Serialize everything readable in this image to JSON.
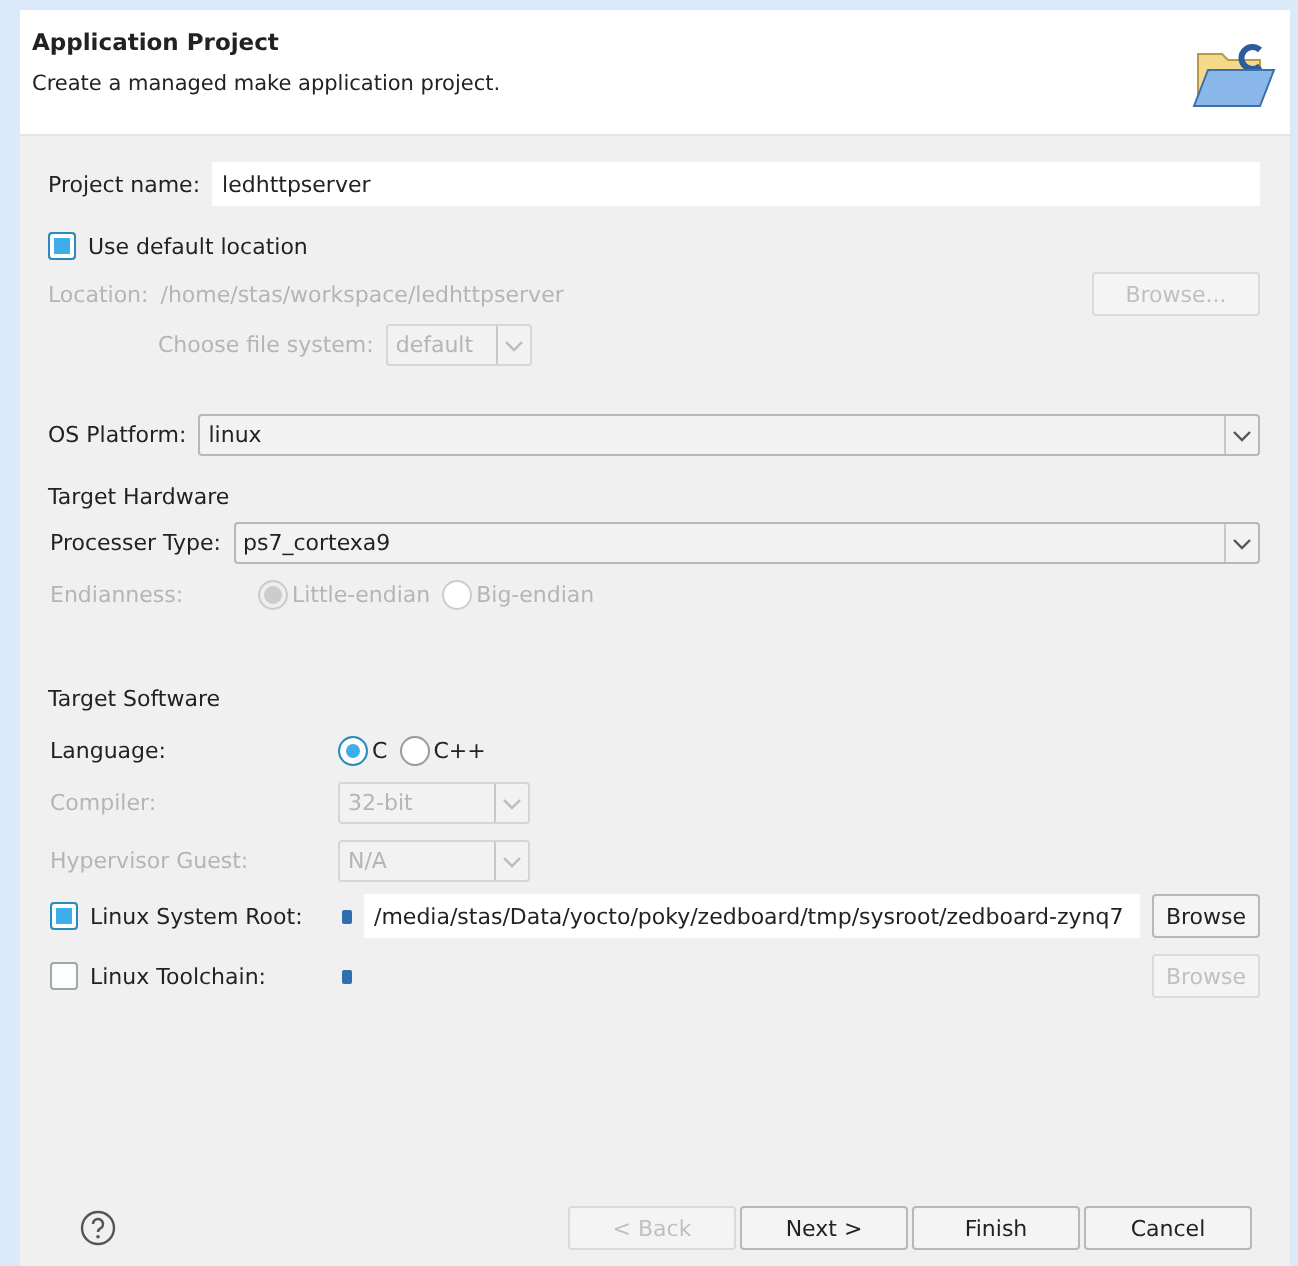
{
  "header": {
    "title": "Application Project",
    "description": "Create a managed make application project."
  },
  "project_name": {
    "label": "Project name:",
    "value": "ledhttpserver"
  },
  "use_default_location": {
    "label": "Use default location",
    "checked": true
  },
  "location": {
    "label": "Location:",
    "value": "/home/stas/workspace/ledhttpserver",
    "disabled": true,
    "browse": {
      "label": "Browse...",
      "disabled": true
    }
  },
  "file_system": {
    "label": "Choose file system:",
    "value": "default",
    "disabled": true
  },
  "os_platform": {
    "label": "OS Platform:",
    "value": "linux"
  },
  "target_hardware": {
    "title": "Target Hardware",
    "processor": {
      "label": "Processer Type:",
      "value": "ps7_cortexa9"
    },
    "endianness": {
      "label": "Endianness:",
      "disabled": true,
      "options": [
        {
          "label": "Little-endian",
          "selected": true
        },
        {
          "label": "Big-endian",
          "selected": false
        }
      ]
    }
  },
  "target_software": {
    "title": "Target Software",
    "language": {
      "label": "Language:",
      "options": [
        {
          "label": "C",
          "selected": true
        },
        {
          "label": "C++",
          "selected": false
        }
      ]
    },
    "compiler": {
      "label": "Compiler:",
      "value": "32-bit",
      "disabled": true
    },
    "hypervisor": {
      "label": "Hypervisor Guest:",
      "value": "N/A",
      "disabled": true
    },
    "paths": [
      {
        "label": "Linux System Root:",
        "checked": true,
        "value": "/media/stas/Data/yocto/poky/zedboard/tmp/sysroot/zedboard-zynq7",
        "browse": {
          "label": "Browse",
          "disabled": false
        }
      },
      {
        "label": "Linux Toolchain:",
        "checked": false,
        "browse": {
          "label": "Browse",
          "disabled": true
        }
      }
    ]
  },
  "buttons": [
    {
      "label": "< Back",
      "disabled": true
    },
    {
      "label": "Next >",
      "disabled": false
    },
    {
      "label": "Finish",
      "disabled": false
    },
    {
      "label": "Cancel",
      "disabled": false
    }
  ]
}
